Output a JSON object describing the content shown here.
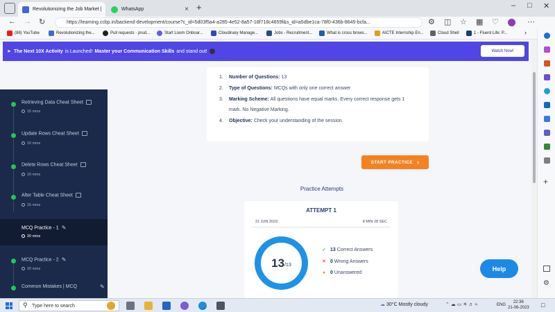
{
  "browser": {
    "tabs": [
      {
        "title": "Revolutionizing the Job Market |",
        "close": "×",
        "active": true
      },
      {
        "title": "WhatsApp",
        "close": "×",
        "active": false
      }
    ],
    "new_tab": "+",
    "url": "https://learning.ccbp.in/backend-development/course?c_id=5d03f5a4-a285-4e52-8a57-18f718c4859f&s_id=a5dbe1ca-78f0-436b-8645-bcfa...",
    "bookmarks": [
      "(88) YouTube",
      "Revolutionizing the...",
      "Pull requests · prud...",
      "Start Loom Onboar...",
      "Cloudinary Manage...",
      "Jobs - Recruitment...",
      "What is cross brows...",
      "AICTE Internship En...",
      "Cloud Shell",
      "1 - Fluent Life: P..."
    ]
  },
  "banner": {
    "prefix": "The Next 10X Activity",
    "middle": "is Launched!",
    "strong": "Master your Communication Skills",
    "suffix": "and stand out!",
    "button": "Watch Now!"
  },
  "sidebar": {
    "items": [
      {
        "title": "Retrieving Data Cheat Sheet",
        "meta": "15 mins",
        "icon": "book-icon"
      },
      {
        "title": "Update Rows Cheat Sheet",
        "meta": "10 mins",
        "icon": "book-icon"
      },
      {
        "title": "Delete Rows Cheat Sheet",
        "meta": "10 mins",
        "icon": "book-icon"
      },
      {
        "title": "Alter Table Cheat Sheet",
        "meta": "15 mins",
        "icon": "book-icon"
      },
      {
        "title": "MCQ Practice - 1",
        "meta": "20 mins",
        "icon": "pencil-icon",
        "active": true
      },
      {
        "title": "MCQ Practice - 2",
        "meta": "20 mins",
        "icon": "pencil-icon"
      },
      {
        "title": "Common Mistakes | MCQ",
        "meta": "",
        "icon": "pencil-icon"
      }
    ]
  },
  "instructions": [
    {
      "num": "1.",
      "label": "Number of Questions:",
      "text": "13"
    },
    {
      "num": "2.",
      "label": "Type of Questions:",
      "text": "MCQs with only one correct answer"
    },
    {
      "num": "3.",
      "label": "Marking Scheme:",
      "text": "All questions have equal marks. Every correct response gets 1 mark. No Negative Marking."
    },
    {
      "num": "4.",
      "label": "Objective:",
      "text": "Check your understanding of the session."
    }
  ],
  "start_button": "START PRACTICE",
  "attempts": {
    "heading": "Practice Attempts",
    "attempt_title": "ATTEMPT 1",
    "date": "21 JUN 2023",
    "duration": "8 MIN 28 SEC",
    "score": "13",
    "total": "/13",
    "correct": {
      "count": "13",
      "label": "Correct Answers"
    },
    "wrong": {
      "count": "0",
      "label": "Wrong Answers"
    },
    "unanswered": {
      "count": "0",
      "label": "Unanswered"
    }
  },
  "help_button": "Help",
  "taskbar": {
    "search_placeholder": "Type here to search",
    "weather": "30°C  Mostly cloudy",
    "lang": "ENG",
    "time": "22:36",
    "date": "21-06-2023"
  },
  "colors": {
    "banner": "#4f46e5",
    "sidebar": "#1b2a4a",
    "start_button": "#f58220",
    "ring": "#1e93e6",
    "help": "#1e88e5"
  }
}
